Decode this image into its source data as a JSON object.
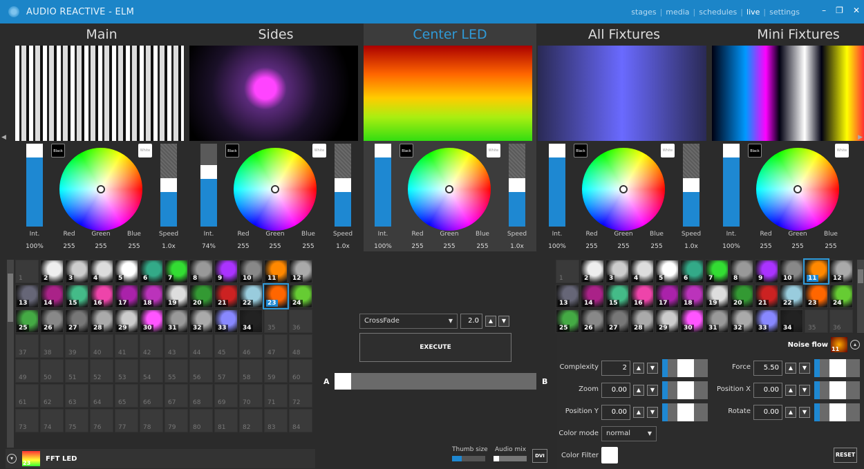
{
  "app": {
    "title": "AUDIO REACTIVE - ELM"
  },
  "nav": {
    "stages": "stages",
    "media": "media",
    "schedules": "schedules",
    "live": "live",
    "settings": "settings"
  },
  "window": {
    "minimize": "–",
    "restore": "❐",
    "close": "✕"
  },
  "labels": {
    "int": "Int.",
    "red": "Red",
    "green": "Green",
    "blue": "Blue",
    "speed": "Speed",
    "black": "Black",
    "white": "White"
  },
  "stages": [
    {
      "name": "Main",
      "int": "100%",
      "red": "255",
      "green": "255",
      "blue": "255",
      "speed": "1.0x",
      "intensity": 1.0,
      "speed_level": 0.5
    },
    {
      "name": "Sides",
      "int": "74%",
      "red": "255",
      "green": "255",
      "blue": "255",
      "speed": "1.0x",
      "intensity": 0.74,
      "speed_level": 0.5
    },
    {
      "name": "Center LED",
      "int": "100%",
      "red": "255",
      "green": "255",
      "blue": "255",
      "speed": "1.0x",
      "intensity": 1.0,
      "speed_level": 0.5
    },
    {
      "name": "All Fixtures",
      "int": "100%",
      "red": "255",
      "green": "255",
      "blue": "255",
      "speed": "1.0x",
      "intensity": 1.0,
      "speed_level": 0.5
    },
    {
      "name": "Mini Fixtures",
      "int": "100%",
      "red": "255",
      "green": "255",
      "blue": "255",
      "intensity": 1.0
    }
  ],
  "left_library": {
    "selected": 23,
    "count": 84
  },
  "right_library": {
    "selected": 11,
    "count": 36
  },
  "footer": {
    "current_effect": "FFT LED",
    "current_num": "23"
  },
  "crossfade": {
    "mode": "CrossFade",
    "duration": "2.0",
    "execute": "EXECUTE",
    "a": "A",
    "b": "B"
  },
  "bottom": {
    "thumb_size": "Thumb size",
    "audio_mix": "Audio mix",
    "dvi": "DVI"
  },
  "effect": {
    "name": "Noise flow",
    "num": "11",
    "complexity_label": "Complexity",
    "complexity": "2",
    "force_label": "Force",
    "force": "5.50",
    "zoom_label": "Zoom",
    "zoom": "0.00",
    "posx_label": "Position X",
    "posx": "0.00",
    "posy_label": "Position Y",
    "posy": "0.00",
    "rotate_label": "Rotate",
    "rotate": "0.00",
    "colormode_label": "Color mode",
    "colormode": "normal",
    "colorfilter_label": "Color Filter",
    "reset": "RESET"
  }
}
